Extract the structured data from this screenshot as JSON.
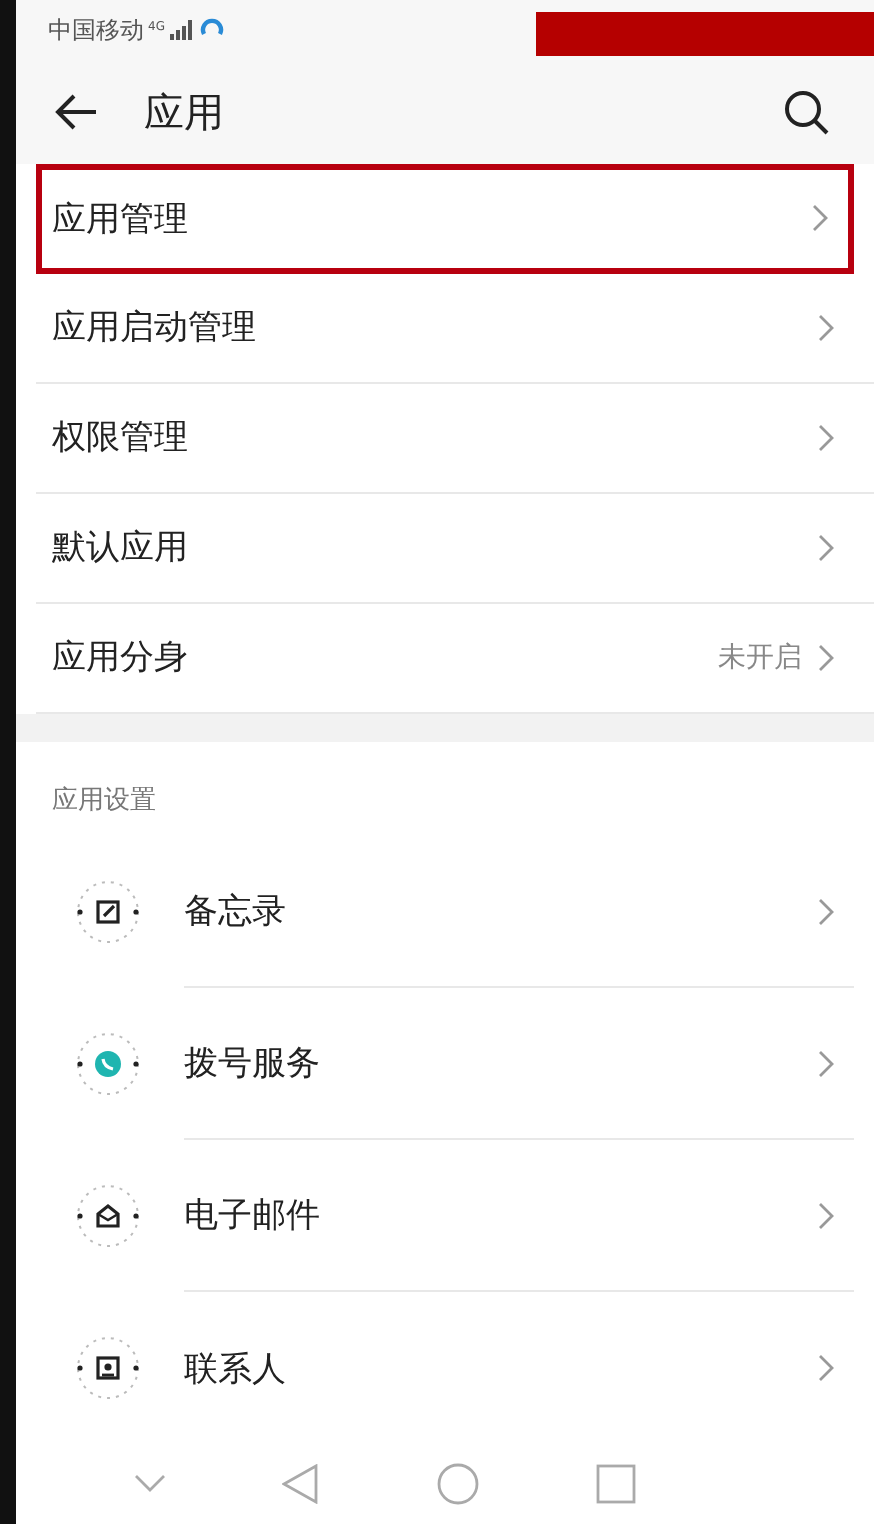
{
  "status_bar": {
    "carrier": "中国移动",
    "network": "4G",
    "redacted": true
  },
  "header": {
    "title": "应用"
  },
  "menu": [
    {
      "label": "应用管理",
      "highlighted": true
    },
    {
      "label": "应用启动管理",
      "highlighted": false
    },
    {
      "label": "权限管理",
      "highlighted": false
    },
    {
      "label": "默认应用",
      "highlighted": false
    },
    {
      "label": "应用分身",
      "value": "未开启",
      "highlighted": false
    }
  ],
  "section": {
    "title": "应用设置"
  },
  "apps": [
    {
      "name": "备忘录",
      "kind": "memo"
    },
    {
      "name": "拨号服务",
      "kind": "phone"
    },
    {
      "name": "电子邮件",
      "kind": "mail"
    },
    {
      "name": "联系人",
      "kind": "contact"
    }
  ]
}
